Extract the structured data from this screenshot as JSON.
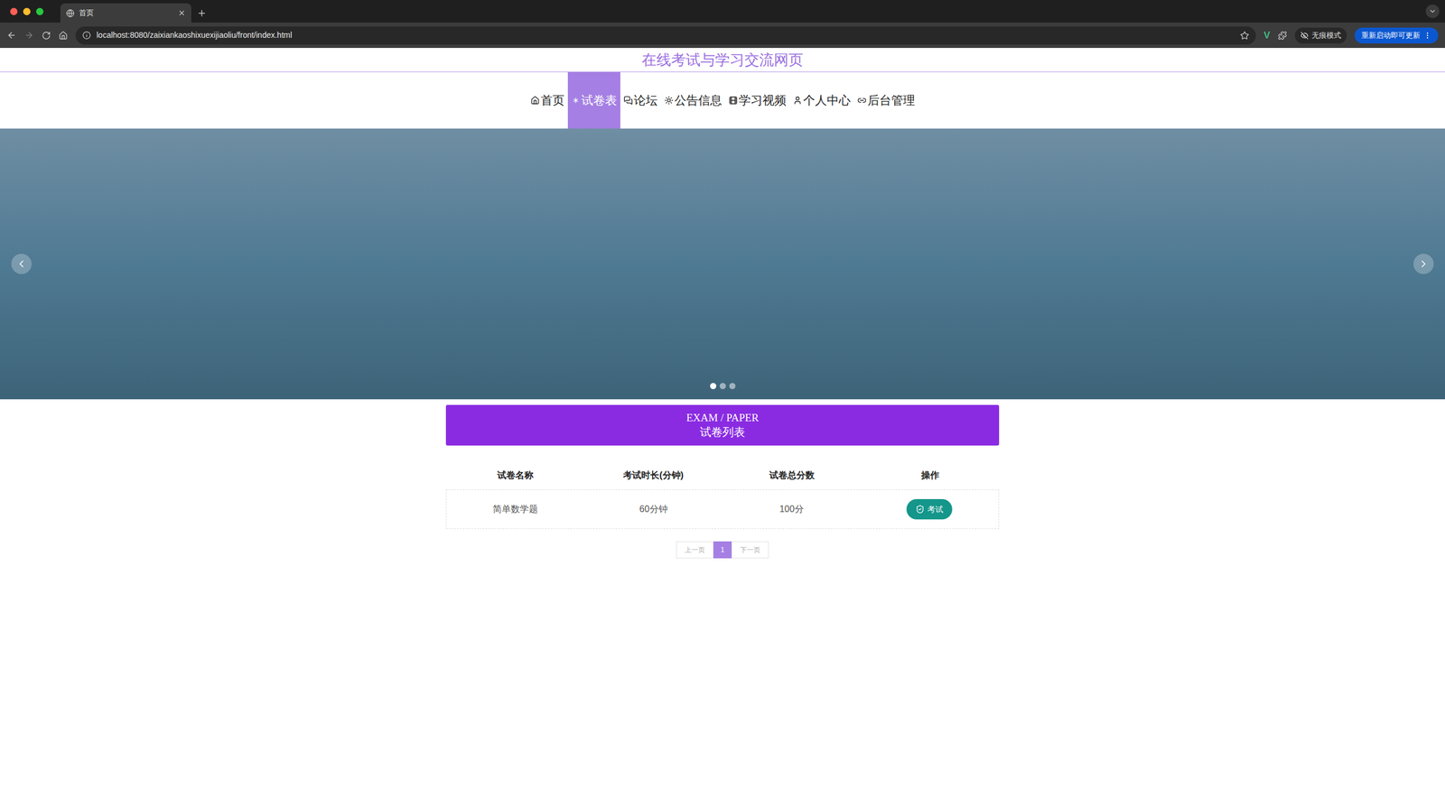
{
  "browser": {
    "tab_title": "首页",
    "url": "localhost:8080/zaixiankaoshixuexijiaoliu/front/index.html",
    "incognito_label": "无痕模式",
    "update_label": "重新启动即可更新",
    "extension_badge": "V"
  },
  "page": {
    "site_title": "在线考试与学习交流网页"
  },
  "nav": [
    {
      "label": "首页",
      "selected": false,
      "icon": "home"
    },
    {
      "label": "试卷表",
      "selected": true,
      "icon": "paper"
    },
    {
      "label": "论坛",
      "selected": false,
      "icon": "forum"
    },
    {
      "label": "公告信息",
      "selected": false,
      "icon": "notice"
    },
    {
      "label": "学习视频",
      "selected": false,
      "icon": "video"
    },
    {
      "label": "个人中心",
      "selected": false,
      "icon": "user"
    },
    {
      "label": "后台管理",
      "selected": false,
      "icon": "admin"
    }
  ],
  "banner": {
    "dots": [
      {
        "selected": true
      },
      {
        "selected": false
      },
      {
        "selected": false
      }
    ]
  },
  "section": {
    "title_en": "EXAM / PAPER",
    "title_zh": "试卷列表"
  },
  "table": {
    "columns": [
      "试卷名称",
      "考试时长(分钟)",
      "试卷总分数",
      "操作"
    ],
    "rows": [
      {
        "name": "简单数学题",
        "duration": "60分钟",
        "score": "100分",
        "action": "考试"
      }
    ]
  },
  "pagination": {
    "prev": {
      "label": "上一页",
      "disabled": true
    },
    "pages": [
      {
        "label": "1",
        "selected": true
      }
    ],
    "next": {
      "label": "下一页",
      "disabled": true
    }
  }
}
